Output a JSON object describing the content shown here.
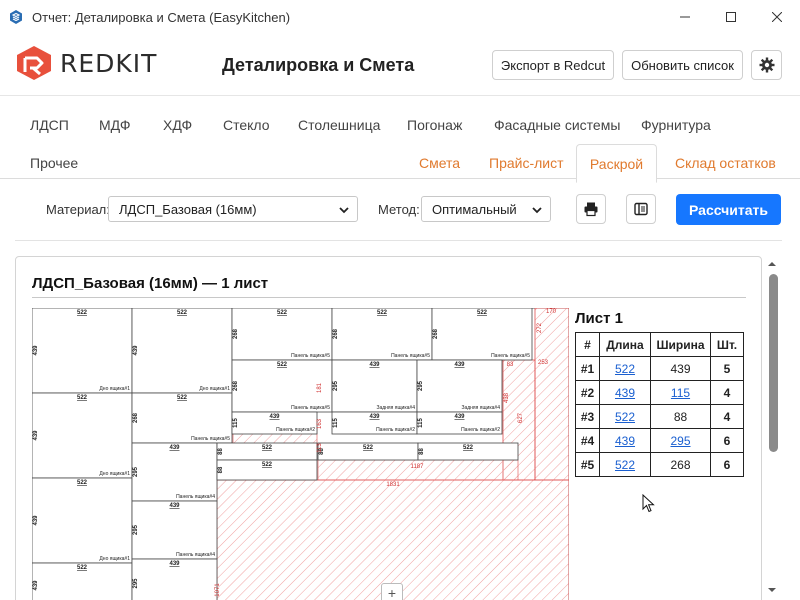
{
  "window": {
    "title": "Отчет: Деталировка и Смета (EasyKitchen)"
  },
  "header": {
    "logo_text": "REDKIT",
    "page_title": "Деталировка и Смета",
    "export_label": "Экспорт в Redcut",
    "refresh_label": "Обновить список",
    "settings_icon": "gear-icon"
  },
  "tabs": {
    "row1": [
      "ЛДСП",
      "МДФ",
      "ХДФ",
      "Стекло",
      "Столешница",
      "Погонаж",
      "Фасадные системы",
      "Фурнитура"
    ],
    "row2_left": "Прочее",
    "row2_right": [
      "Смета",
      "Прайс-лист",
      "Раскрой",
      "Склад остатков"
    ],
    "active": "Раскрой"
  },
  "toolbar": {
    "material_label": "Материал:",
    "material_value": "ЛДСП_Базовая (16мм)",
    "method_label": "Метод:",
    "method_value": "Оптимальный",
    "print_icon": "print-icon",
    "panel_icon": "panel-toggle-icon",
    "calculate_label": "Рассчитать"
  },
  "panel": {
    "title": "ЛДСП_Базовая (16мм) — 1 лист"
  },
  "sheet": {
    "caption": "Лист 1",
    "columns": [
      "#",
      "Длина",
      "Ширина",
      "Шт."
    ],
    "rows": [
      {
        "id": "#1",
        "length": "522",
        "width": "439",
        "qty": "5",
        "length_link": true,
        "width_link": false
      },
      {
        "id": "#2",
        "length": "439",
        "width": "115",
        "qty": "4",
        "length_link": true,
        "width_link": true
      },
      {
        "id": "#3",
        "length": "522",
        "width": "88",
        "qty": "4",
        "length_link": true,
        "width_link": false
      },
      {
        "id": "#4",
        "length": "439",
        "width": "295",
        "qty": "6",
        "length_link": true,
        "width_link": true
      },
      {
        "id": "#5",
        "length": "522",
        "width": "268",
        "qty": "6",
        "length_link": true,
        "width_link": false
      }
    ]
  },
  "diagram": {
    "labels": {
      "bottom": "Дно ящика",
      "panel": "Панель ящика",
      "back": "Задняя ящика"
    },
    "waste_labels": [
      "170",
      "272",
      "253",
      "83",
      "627",
      "438",
      "1187",
      "1831",
      "1071",
      "181",
      "163",
      "113"
    ],
    "zoom_plus": "+"
  },
  "colors": {
    "accent": "#e07a2e",
    "primary": "#1677ff",
    "link": "#1a5fd0",
    "waste": "#e05050"
  }
}
